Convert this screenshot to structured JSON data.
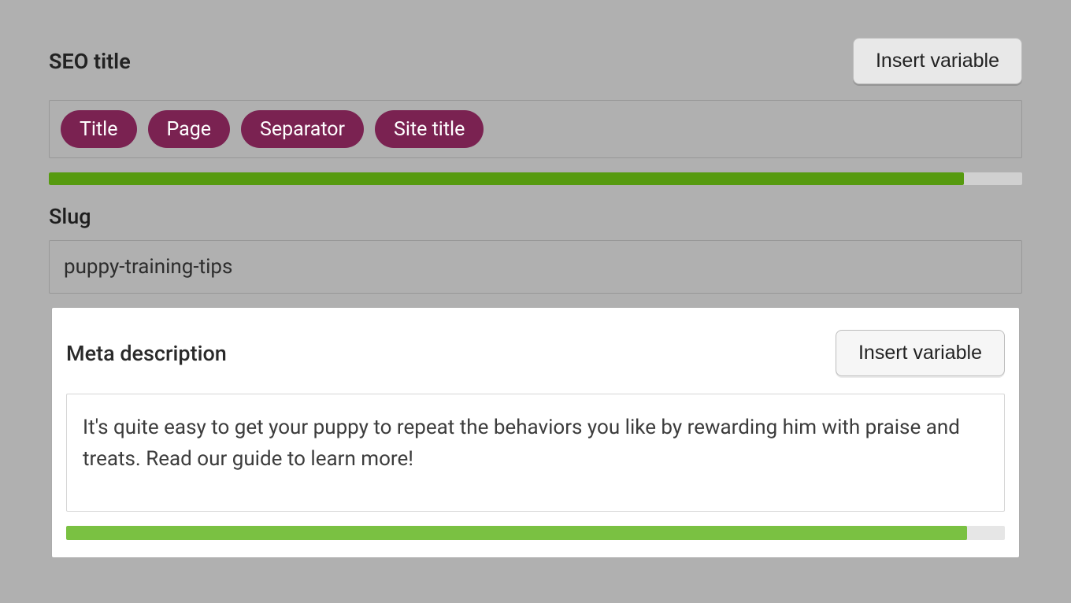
{
  "seo_title": {
    "label": "SEO title",
    "insert_button": "Insert variable",
    "tokens": [
      "Title",
      "Page",
      "Separator",
      "Site title"
    ],
    "progress_percent": 94,
    "progress_color": "#569a0f"
  },
  "slug": {
    "label": "Slug",
    "value": "puppy-training-tips"
  },
  "meta_description": {
    "label": "Meta description",
    "insert_button": "Insert variable",
    "value": "It's quite easy to get your puppy to repeat the behaviors you like by rewarding him with praise and treats. Read our guide to learn more!",
    "progress_percent": 96,
    "progress_color": "#7ac142"
  }
}
